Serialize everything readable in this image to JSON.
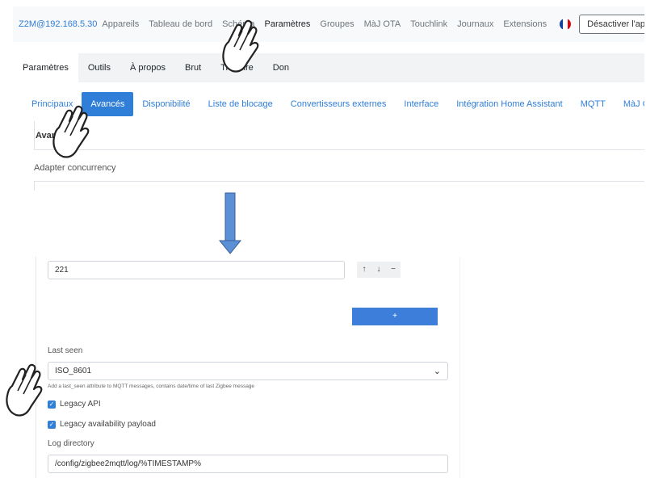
{
  "navbar": {
    "host": "Z2M@192.168.5.30",
    "links": [
      "Appareils",
      "Tableau de bord",
      "Schéma",
      "Paramètres",
      "Groupes",
      "MàJ OTA",
      "Touchlink",
      "Journaux",
      "Extensions"
    ],
    "active_link": "Paramètres",
    "language_flag": "french-flag-icon",
    "disable_button": "Désactiver l'appairage"
  },
  "subtabs": [
    "Paramètres",
    "Outils",
    "À propos",
    "Brut",
    "Traduire",
    "Don"
  ],
  "settings_tabs": [
    "Principaux",
    "Avancés",
    "Disponibilité",
    "Liste de blocage",
    "Convertisseurs externes",
    "Interface",
    "Intégration Home Assistant",
    "MQTT",
    "MàJ OTA"
  ],
  "section_title": "Avancés",
  "top_field_label": "Adapter concurrency",
  "adapter_concurrency": {
    "value": "221",
    "buttons": [
      "↑",
      "↓",
      "−"
    ],
    "add_button": "+"
  },
  "last_seen": {
    "label": "Last seen",
    "value": "ISO_8601",
    "help": "Add a last_seen attribute to MQTT messages, contains date/time of last Zigbee message"
  },
  "checkboxes": [
    {
      "label": "Legacy API",
      "checked": true
    },
    {
      "label": "Legacy availability payload",
      "checked": true
    }
  ],
  "log_directory": {
    "label": "Log directory",
    "value": "/config/zigbee2mqtt/log/%TIMESTAMP%"
  },
  "colors": {
    "accent": "#2f7ed8",
    "arrow": "#5b8fd6"
  }
}
